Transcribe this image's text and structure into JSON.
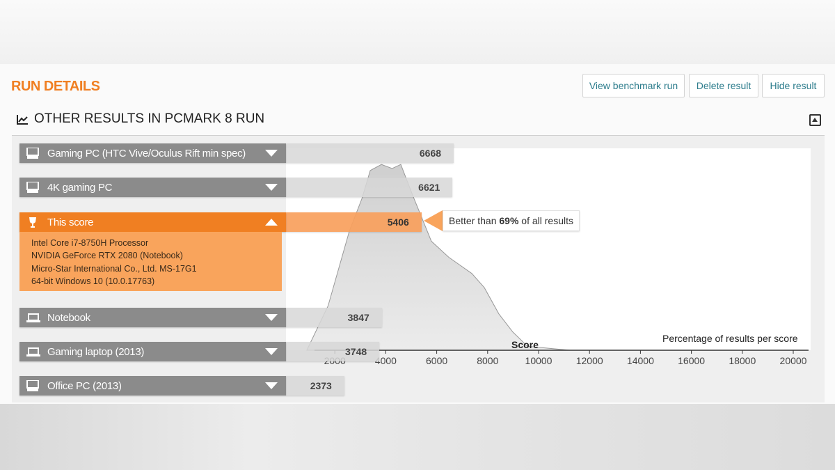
{
  "header": {
    "title": "RUN DETAILS",
    "buttons": [
      "View benchmark run",
      "Delete result",
      "Hide result"
    ]
  },
  "section": {
    "title": "OTHER RESULTS IN PCMARK 8 RUN"
  },
  "rows": [
    {
      "label": "Gaming PC (HTC Vive/Oculus Rift min spec)",
      "score": "6668",
      "value": 6668,
      "icon": "desktop-icon"
    },
    {
      "label": "4K gaming PC",
      "score": "6621",
      "value": 6621,
      "icon": "desktop-icon"
    },
    {
      "label": "This score",
      "score": "5406",
      "value": 5406,
      "icon": "trophy-icon",
      "active": true
    },
    {
      "label": "Notebook",
      "score": "3847",
      "value": 3847,
      "icon": "laptop-icon"
    },
    {
      "label": "Gaming laptop (2013)",
      "score": "3748",
      "value": 3748,
      "icon": "laptop-icon"
    },
    {
      "label": "Office PC (2013)",
      "score": "2373",
      "value": 2373,
      "icon": "desktop-icon"
    }
  ],
  "this_score_details": [
    "Intel Core i7-8750H Processor",
    "NVIDIA GeForce RTX 2080 (Notebook)",
    "Micro-Star International Co., Ltd. MS-17G1",
    "64-bit Windows 10 (10.0.17763)"
  ],
  "callout": {
    "prefix": "Better than ",
    "percent": "69%",
    "suffix": " of all results"
  },
  "colors": {
    "accent": "#f07f22",
    "link": "#2c7c8c"
  },
  "chart_data": {
    "type": "area",
    "xlabel": "Score",
    "ylabel": "Percentage of results per score",
    "xlim": [
      0,
      20600
    ],
    "xticks": [
      2000,
      4000,
      6000,
      8000,
      10000,
      12000,
      14000,
      16000,
      18000,
      20000
    ],
    "x": [
      900,
      1735,
      2570,
      3060,
      3390,
      3830,
      4250,
      4590,
      5080,
      5790,
      6480,
      7380,
      7870,
      8440,
      8990,
      9560,
      10380,
      11230
    ],
    "y": [
      0,
      22,
      59,
      75,
      89,
      92,
      90,
      92,
      76,
      54,
      46,
      38,
      31,
      18,
      9,
      2,
      1,
      0
    ]
  }
}
